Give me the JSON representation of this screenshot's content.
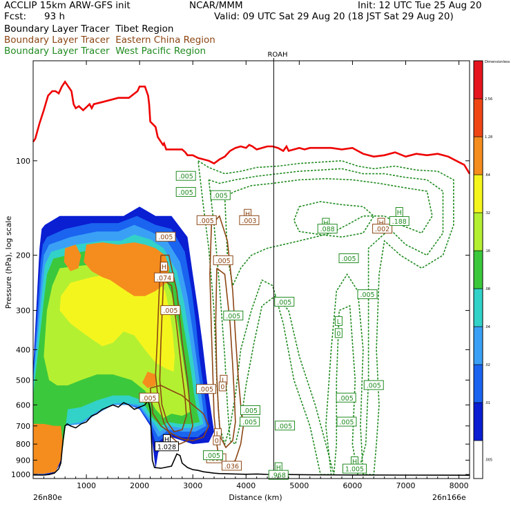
{
  "header": {
    "line1_left": "ACCLIP 15km ARW-GFS init",
    "line1_mid": "NCAR/MMM",
    "line1_right": "Init: 12 UTC Tue 25 Aug 20",
    "line2_left": "Fcst:",
    "line2_fcst": "93 h",
    "line2_right": "Valid: 09 UTC Sat 29 Aug 20 (18 JST Sat 29 Aug 20)"
  },
  "legend": [
    {
      "prefix": "Boundary Layer Tracer",
      "region": "Tibet Region",
      "color": "#000000"
    },
    {
      "prefix": "Boundary Layer Tracer",
      "region": "Eastern China Region",
      "color": "#8b4513"
    },
    {
      "prefix": "Boundary Layer Tracer",
      "region": "West Pacific Region",
      "color": "#1f8a1f"
    }
  ],
  "chart_data": {
    "type": "cross-section",
    "xlabel": "Distance (km)",
    "ylabel": "Pressure (hPa), log scale",
    "x_start_label": "26n80e",
    "x_end_label": "26n166e",
    "xlim": [
      0,
      8200
    ],
    "ylim": [
      1030,
      48
    ],
    "x_ticks": [
      1000,
      2000,
      3000,
      4000,
      5000,
      6000,
      7000,
      8000
    ],
    "y_ticks": [
      100,
      200,
      300,
      400,
      500,
      600,
      700,
      800,
      900,
      1000
    ],
    "station": {
      "name": "ROAH",
      "x": 4520
    },
    "colorbar": {
      "top_label": "Dimensionless",
      "levels": [
        ".005",
        ".01",
        ".02",
        ".04",
        ".08",
        ".16",
        ".32",
        ".64",
        "1.28",
        "2.56"
      ],
      "colors": [
        "#ffffff",
        "#0a1ed2",
        "#1a64f0",
        "#3aa0f5",
        "#32d2c8",
        "#3cc83c",
        "#b4f032",
        "#f5f51e",
        "#f58c1e",
        "#f04614",
        "#e6141e"
      ]
    },
    "tropopause": {
      "color": "#ee0000",
      "points": [
        [
          0,
          87
        ],
        [
          40,
          85
        ],
        [
          120,
          76
        ],
        [
          200,
          69
        ],
        [
          280,
          62
        ],
        [
          360,
          60
        ],
        [
          420,
          60
        ],
        [
          480,
          61
        ],
        [
          540,
          58
        ],
        [
          600,
          56
        ],
        [
          660,
          58
        ],
        [
          720,
          60
        ],
        [
          760,
          66
        ],
        [
          800,
          68
        ],
        [
          860,
          67
        ],
        [
          940,
          69
        ],
        [
          1020,
          67
        ],
        [
          1060,
          66
        ],
        [
          1100,
          68
        ],
        [
          1140,
          66
        ],
        [
          1300,
          65
        ],
        [
          1600,
          63
        ],
        [
          1800,
          63
        ],
        [
          1960,
          60
        ],
        [
          2000,
          58
        ],
        [
          2100,
          58
        ],
        [
          2160,
          62
        ],
        [
          2180,
          66
        ],
        [
          2200,
          75
        ],
        [
          2300,
          78
        ],
        [
          2340,
          84
        ],
        [
          2400,
          87
        ],
        [
          2440,
          89
        ],
        [
          2460,
          88
        ],
        [
          2500,
          92
        ],
        [
          2800,
          92
        ],
        [
          2860,
          94
        ],
        [
          2900,
          96
        ],
        [
          3000,
          96
        ],
        [
          3100,
          98
        ],
        [
          3200,
          99
        ],
        [
          3300,
          100
        ],
        [
          3400,
          102
        ],
        [
          3500,
          99
        ],
        [
          3600,
          97
        ],
        [
          3700,
          93
        ],
        [
          3800,
          91
        ],
        [
          3900,
          90
        ],
        [
          4000,
          91
        ],
        [
          4060,
          89
        ],
        [
          4120,
          90
        ],
        [
          4200,
          92
        ],
        [
          4300,
          91
        ],
        [
          4400,
          90
        ],
        [
          4500,
          90
        ],
        [
          4600,
          91
        ],
        [
          4700,
          93
        ],
        [
          4760,
          90
        ],
        [
          4800,
          93
        ],
        [
          4900,
          92
        ],
        [
          5000,
          91
        ],
        [
          5100,
          92
        ],
        [
          5200,
          91
        ],
        [
          5400,
          91
        ],
        [
          5600,
          91
        ],
        [
          5800,
          92
        ],
        [
          6000,
          91
        ],
        [
          6100,
          93
        ],
        [
          6200,
          95
        ],
        [
          6300,
          96
        ],
        [
          6400,
          97
        ],
        [
          6600,
          96
        ],
        [
          6800,
          94
        ],
        [
          7000,
          97
        ],
        [
          7200,
          95
        ],
        [
          7400,
          96
        ],
        [
          7600,
          95
        ],
        [
          7800,
          97
        ],
        [
          8000,
          101
        ],
        [
          8100,
          103
        ],
        [
          8200,
          110
        ]
      ]
    },
    "terrain": {
      "color": "#000000",
      "points": [
        [
          0,
          1003
        ],
        [
          200,
          1004
        ],
        [
          300,
          1000
        ],
        [
          400,
          990
        ],
        [
          480,
          960
        ],
        [
          520,
          920
        ],
        [
          560,
          780
        ],
        [
          600,
          700
        ],
        [
          640,
          690
        ],
        [
          700,
          700
        ],
        [
          800,
          710
        ],
        [
          900,
          690
        ],
        [
          1000,
          680
        ],
        [
          1100,
          650
        ],
        [
          1200,
          640
        ],
        [
          1300,
          620
        ],
        [
          1400,
          610
        ],
        [
          1500,
          600
        ],
        [
          1600,
          610
        ],
        [
          1700,
          590
        ],
        [
          1800,
          600
        ],
        [
          1900,
          620
        ],
        [
          2000,
          610
        ],
        [
          2100,
          600
        ],
        [
          2160,
          580
        ],
        [
          2200,
          620
        ],
        [
          2240,
          900
        ],
        [
          2280,
          950
        ],
        [
          2400,
          955
        ],
        [
          2600,
          940
        ],
        [
          2700,
          860
        ],
        [
          2760,
          870
        ],
        [
          2800,
          920
        ],
        [
          2900,
          950
        ],
        [
          3000,
          965
        ],
        [
          3100,
          970
        ],
        [
          3200,
          980
        ],
        [
          3300,
          985
        ],
        [
          3400,
          990
        ],
        [
          3500,
          993
        ],
        [
          3800,
          996
        ],
        [
          4000,
          998
        ],
        [
          4200,
          996
        ],
        [
          4400,
          999
        ],
        [
          4800,
          1000
        ],
        [
          5200,
          1002
        ],
        [
          6000,
          1003
        ],
        [
          7000,
          1004
        ],
        [
          8200,
          1005
        ]
      ]
    },
    "contour_labels": [
      {
        "text": ".005",
        "x": 2490,
        "y": 175,
        "color": "#8b4513"
      },
      {
        "text": "H",
        "x": 2460,
        "y": 218,
        "color": "#8b4513"
      },
      {
        "text": ".074",
        "x": 2460,
        "y": 236,
        "color": "#8b4513"
      },
      {
        "text": ".005",
        "x": 3570,
        "y": 208,
        "color": "#8b4513"
      },
      {
        "text": "L",
        "x": 3580,
        "y": 500,
        "color": "#8b4513"
      },
      {
        "text": "0",
        "x": 3560,
        "y": 525,
        "color": "#8b4513"
      },
      {
        "text": ".005",
        "x": 2180,
        "y": 570,
        "color": "#8b4513"
      },
      {
        "text": "H",
        "x": 2510,
        "y": 773,
        "color": "#000000"
      },
      {
        "text": "1.028",
        "x": 2510,
        "y": 815,
        "color": "#000000"
      },
      {
        "text": ".005",
        "x": 2580,
        "y": 300,
        "color": "#8b4513"
      },
      {
        "text": ".005",
        "x": 3250,
        "y": 535,
        "color": "#8b4513"
      },
      {
        "text": ".005",
        "x": 3260,
        "y": 155,
        "color": "#8b4513"
      },
      {
        "text": "H",
        "x": 4030,
        "y": 148,
        "color": "#8b4513"
      },
      {
        "text": ".003",
        "x": 4060,
        "y": 155,
        "color": "#8b4513"
      },
      {
        "text": "H",
        "x": 5500,
        "y": 158,
        "color": "#1f8a1f"
      },
      {
        "text": ".088",
        "x": 5530,
        "y": 165,
        "color": "#1f8a1f"
      },
      {
        "text": "H",
        "x": 6540,
        "y": 158,
        "color": "#8b4513"
      },
      {
        "text": ".002",
        "x": 6560,
        "y": 165,
        "color": "#8b4513"
      },
      {
        "text": "H",
        "x": 6880,
        "y": 146,
        "color": "#1f8a1f"
      },
      {
        "text": ".188",
        "x": 6880,
        "y": 156,
        "color": "#1f8a1f"
      },
      {
        "text": ".005",
        "x": 2870,
        "y": 112,
        "color": "#1f8a1f"
      },
      {
        "text": ".005",
        "x": 2870,
        "y": 126,
        "color": "#1f8a1f"
      },
      {
        "text": ".005",
        "x": 3520,
        "y": 129,
        "color": "#1f8a1f"
      },
      {
        "text": ".005",
        "x": 3760,
        "y": 312,
        "color": "#1f8a1f"
      },
      {
        "text": ".005",
        "x": 4720,
        "y": 282,
        "color": "#1f8a1f"
      },
      {
        "text": ".005",
        "x": 5930,
        "y": 205,
        "color": "#1f8a1f"
      },
      {
        "text": ".005",
        "x": 6280,
        "y": 267,
        "color": "#1f8a1f"
      },
      {
        "text": "L",
        "x": 5740,
        "y": 325,
        "color": "#1f8a1f"
      },
      {
        "text": "0",
        "x": 5740,
        "y": 355,
        "color": "#1f8a1f"
      },
      {
        "text": ".005",
        "x": 6400,
        "y": 520,
        "color": "#1f8a1f"
      },
      {
        "text": ".005",
        "x": 5880,
        "y": 570,
        "color": "#1f8a1f"
      },
      {
        "text": ".005",
        "x": 5890,
        "y": 680,
        "color": "#1f8a1f"
      },
      {
        "text": ".005",
        "x": 4730,
        "y": 700,
        "color": "#1f8a1f"
      },
      {
        "text": ".005",
        "x": 4080,
        "y": 625,
        "color": "#1f8a1f"
      },
      {
        "text": ".005",
        "x": 4070,
        "y": 680,
        "color": "#1f8a1f"
      },
      {
        "text": "H",
        "x": 6040,
        "y": 910,
        "color": "#1f8a1f"
      },
      {
        "text": "1.005",
        "x": 6040,
        "y": 960,
        "color": "#1f8a1f"
      },
      {
        "text": ".005",
        "x": 3440,
        "y": 890,
        "color": "#8b4513"
      },
      {
        "text": ".005",
        "x": 3380,
        "y": 870,
        "color": "#1f8a1f"
      },
      {
        "text": ".036",
        "x": 3730,
        "y": 940,
        "color": "#8b4513"
      },
      {
        "text": "H",
        "x": 4610,
        "y": 950,
        "color": "#1f8a1f"
      },
      {
        "text": ".968",
        "x": 4610,
        "y": 1005,
        "color": "#1f8a1f"
      },
      {
        "text": "L",
        "x": 3470,
        "y": 740,
        "color": "#8b4513"
      },
      {
        "text": "0",
        "x": 3450,
        "y": 780,
        "color": "#8b4513"
      }
    ]
  }
}
